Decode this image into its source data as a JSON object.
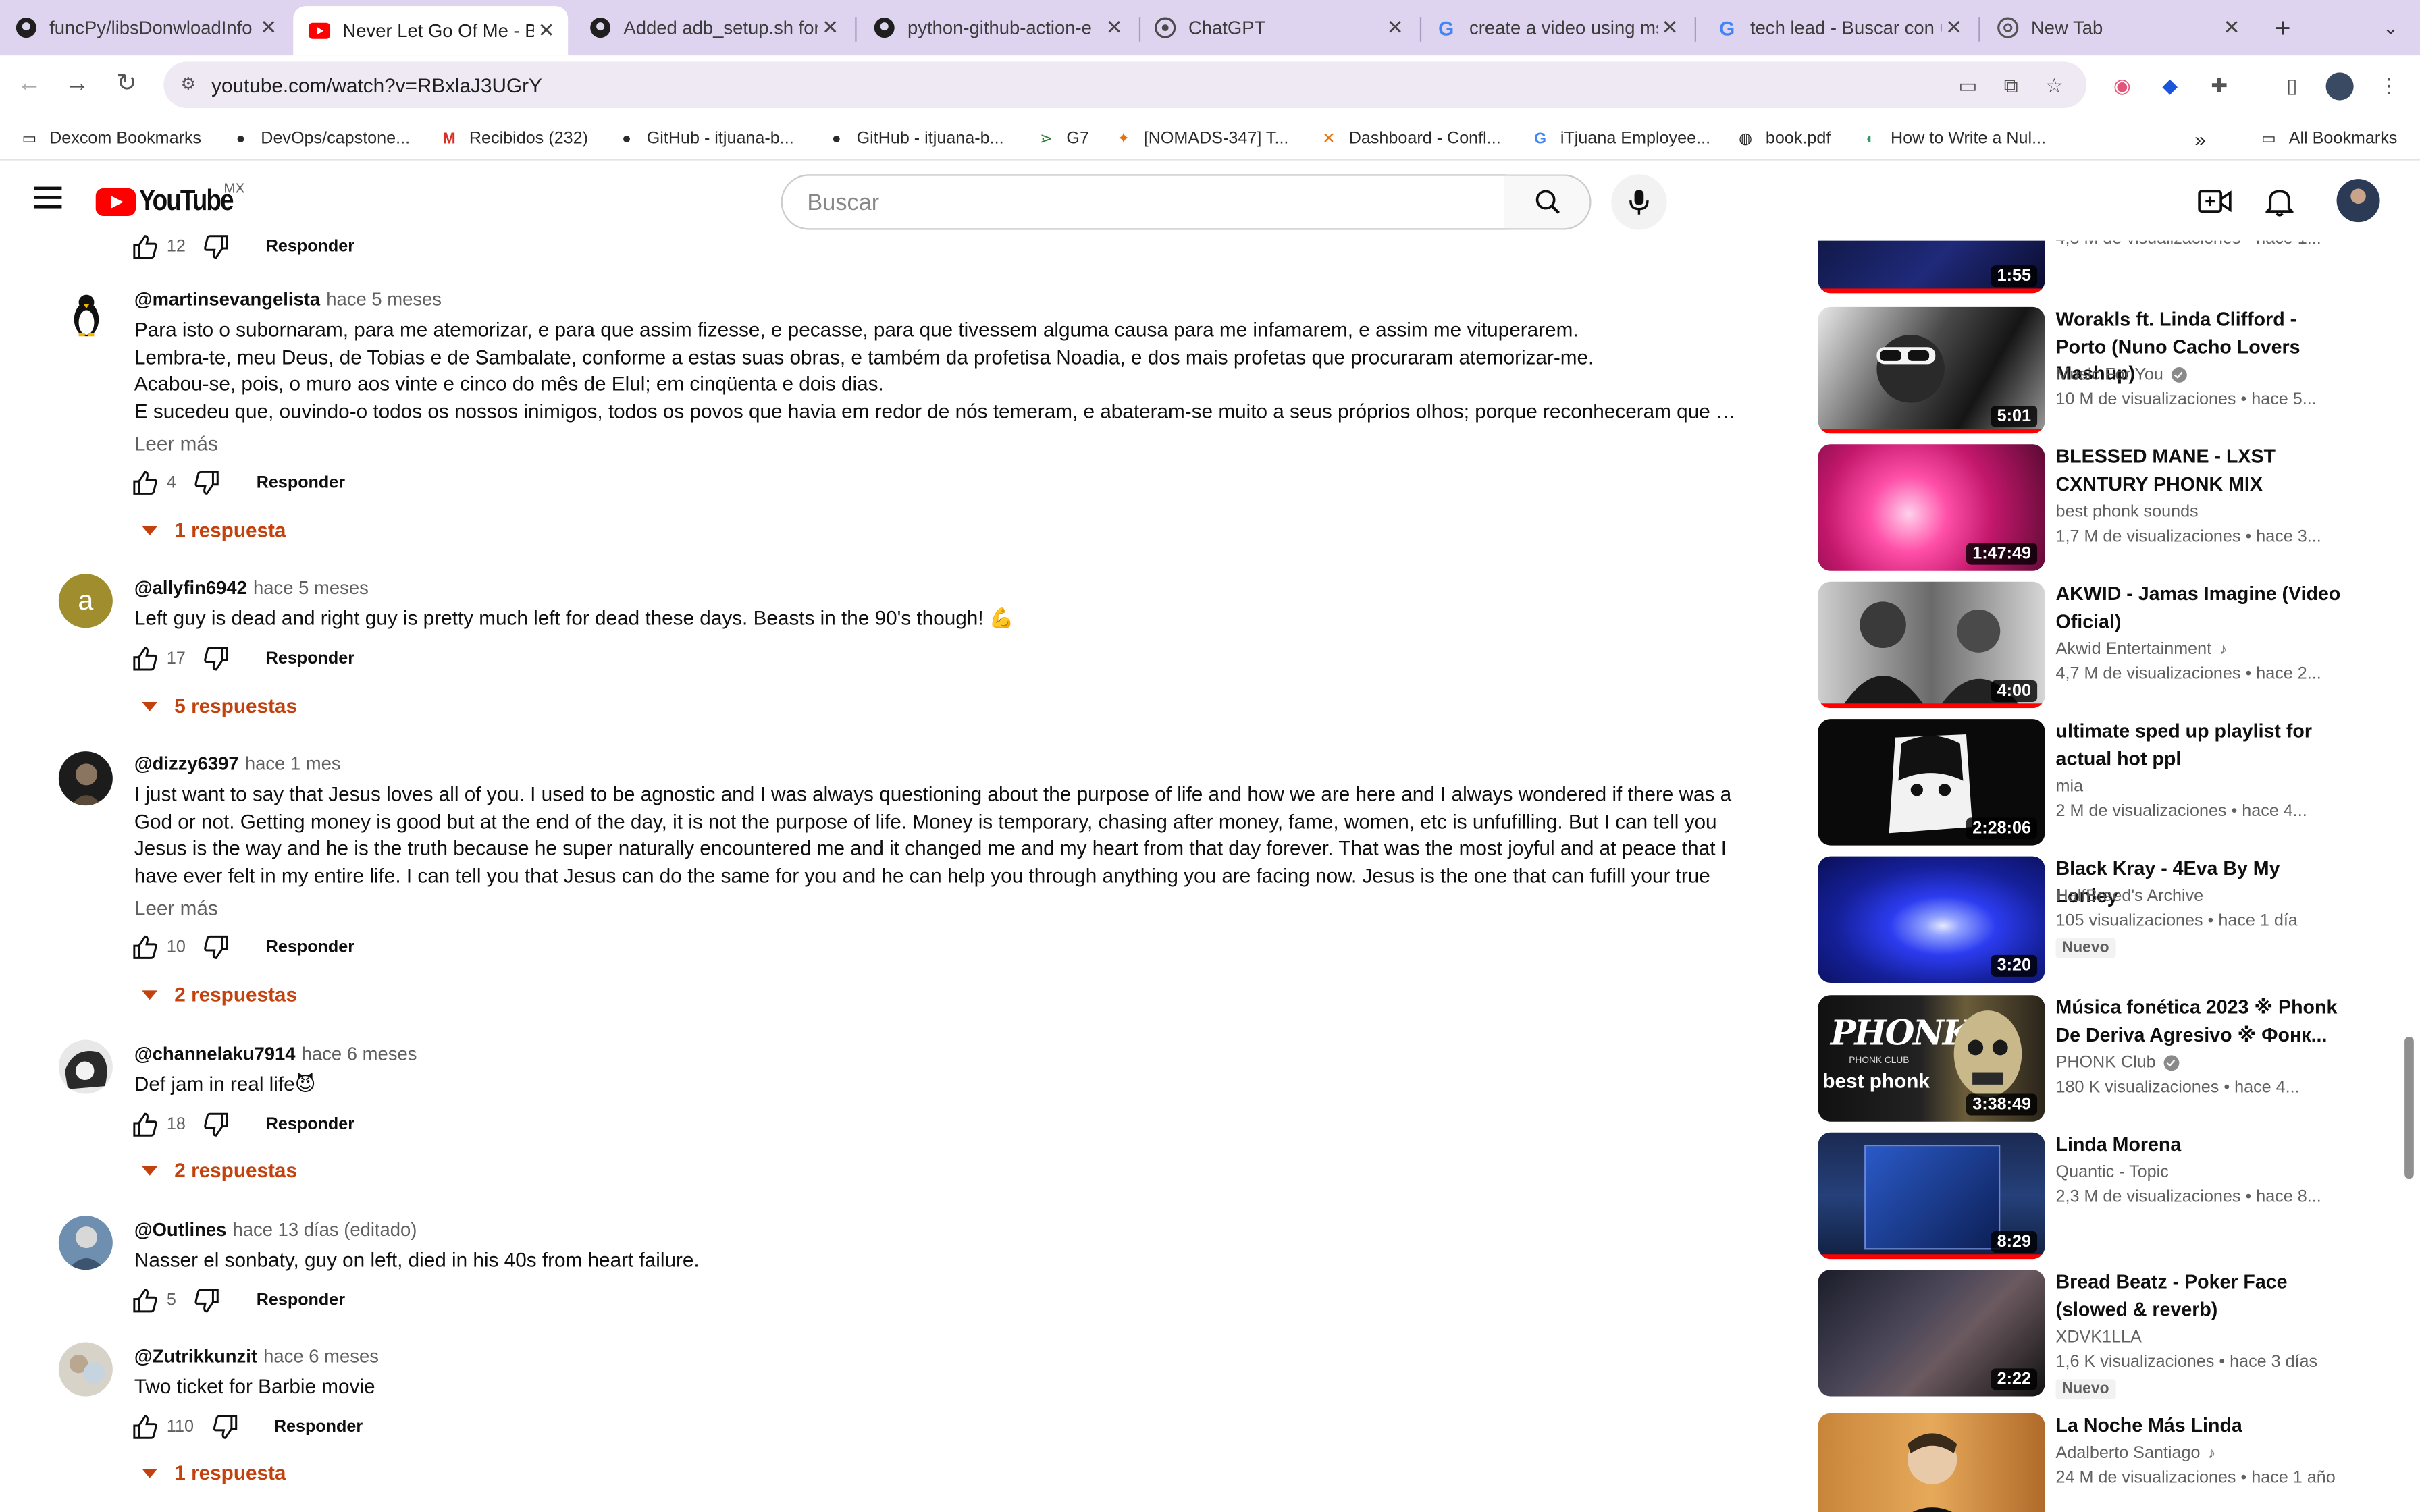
{
  "browser": {
    "tabs": [
      {
        "title": "funcPy/libsDonwloadInfo",
        "icon": "github-icon"
      },
      {
        "title": "Never Let Go Of Me - Ba",
        "icon": "youtube-icon",
        "active": true
      },
      {
        "title": "Added adb_setup.sh for",
        "icon": "github-icon"
      },
      {
        "title": "python-github-action-e",
        "icon": "github-icon"
      },
      {
        "title": "ChatGPT",
        "icon": "chatgpt-icon"
      },
      {
        "title": "create a video using ms",
        "icon": "google-icon"
      },
      {
        "title": "tech lead - Buscar con G",
        "icon": "google-icon"
      },
      {
        "title": "New Tab",
        "icon": "chrome-icon"
      }
    ],
    "url": "youtube.com/watch?v=RBxlaJ3UGrY",
    "bookmarks": [
      {
        "label": "Dexcom Bookmarks",
        "icon": "folder-icon"
      },
      {
        "label": "DevOps/capstone...",
        "icon": "github-icon"
      },
      {
        "label": "Recibidos (232)",
        "icon": "gmail-icon"
      },
      {
        "label": "GitHub - itjuana-b...",
        "icon": "github-icon"
      },
      {
        "label": "GitHub - itjuana-b...",
        "icon": "github-icon"
      },
      {
        "label": "G7",
        "icon": "g7-icon"
      },
      {
        "label": "[NOMADS-347] T...",
        "icon": "jira-icon"
      },
      {
        "label": "Dashboard - Confl...",
        "icon": "confluence-icon"
      },
      {
        "label": "iTjuana Employee...",
        "icon": "google-icon"
      },
      {
        "label": "book.pdf",
        "icon": "globe-icon"
      },
      {
        "label": "How to Write a Nul...",
        "icon": "site-icon"
      }
    ],
    "all_bookmarks": "All Bookmarks"
  },
  "youtube": {
    "logo_text": "YouTube",
    "region": "MX",
    "search_placeholder": "Buscar"
  },
  "comments": {
    "top_fragment": {
      "likes": "12",
      "reply_label": "Responder"
    },
    "items": [
      {
        "handle": "@martinsevangelista",
        "time": "hace 5 meses",
        "lines": [
          "Para isto o subornaram, para me atemorizar, e para que assim fizesse, e pecasse, para que tivessem alguma causa para me infamarem, e assim me vituperarem.",
          "Lembra-te, meu Deus, de Tobias e de Sambalate, conforme a estas suas obras, e também da profetisa Noadia, e dos mais profetas que procuraram atemorizar-me.",
          "Acabou-se, pois, o muro aos vinte e cinco do mês de Elul; em cinqüenta e dois dias.",
          "E sucedeu que, ouvindo-o todos os nossos inimigos, todos os povos que havia em redor de nós temeram, e abateram-se muito a seus próprios olhos; porque reconheceram que o nosso Deus fez esta obra."
        ],
        "read_more": "Leer más",
        "likes": "4",
        "reply_label": "Responder",
        "replies": "1 respuesta"
      },
      {
        "handle": "@allyfin6942",
        "time": "hace 5 meses",
        "avatar_letter": "a",
        "lines": [
          "Left guy is dead and right guy is pretty much left for dead these days.  Beasts in the 90's though! 💪"
        ],
        "likes": "17",
        "reply_label": "Responder",
        "replies": "5 respuestas"
      },
      {
        "handle": "@dizzy6397",
        "time": "hace 1 mes",
        "text": "I just want to say that Jesus loves all of you. I used to be agnostic and I was always questioning about the purpose of life and how we are here and I always wondered if there was a God or not. Getting money is good but at the end of the day, it is not the purpose of life. Money is temporary, chasing after money, fame, women, etc is unfufilling. But I can tell you Jesus is the way and he is the truth because he super naturally encountered me and it changed me and my heart from that day forever. That was the most joyful and at peace that I have ever felt in my entire life. I can tell you that Jesus can do the same for you and he can help you through anything you are facing now. Jesus is the one that can fufill your true purpose in life. Following Jesus is not about a …",
        "read_more": "Leer más",
        "likes": "10",
        "reply_label": "Responder",
        "replies": "2 respuestas"
      },
      {
        "handle": "@channelaku7914",
        "time": "hace 6 meses",
        "lines": [
          "Def jam in real life😈"
        ],
        "likes": "18",
        "reply_label": "Responder",
        "replies": "2 respuestas"
      },
      {
        "handle": "@Outlines",
        "time": "hace 13 días (editado)",
        "lines": [
          "Nasser el sonbaty, guy on left, died in his 40s from heart failure."
        ],
        "likes": "5",
        "reply_label": "Responder"
      },
      {
        "handle": "@Zutrikkunzit",
        "time": "hace 6 meses",
        "lines": [
          "Two ticket for Barbie movie"
        ],
        "likes": "110",
        "reply_label": "Responder",
        "replies": "1 respuesta"
      }
    ]
  },
  "sidebar": {
    "top_fragment": {
      "duration": "1:55",
      "meta": "4,8 M de visualizaciones • hace 1..."
    },
    "videos": [
      {
        "title": "Worakls ft. Linda Clifford - Porto (Nuno Cacho Lovers Mashup)",
        "channel": "Music For You",
        "verified": true,
        "meta": "10 M de visualizaciones • hace 5...",
        "duration": "5:01",
        "watched": 1.0
      },
      {
        "title": "BLESSED MANE - LXST CXNTURY PHONK MIX",
        "channel": "best phonk sounds",
        "meta": "1,7 M de visualizaciones • hace 3...",
        "duration": "1:47:49"
      },
      {
        "title": "AKWID - Jamas Imagine (Video Oficial)",
        "channel": "Akwid Entertainment",
        "music": true,
        "meta": "4,7 M de visualizaciones • hace 2...",
        "duration": "4:00",
        "watched": 1.0
      },
      {
        "title": "ultimate sped up playlist for actual hot ppl",
        "channel": "mia",
        "meta": "2 M de visualizaciones • hace 4...",
        "duration": "2:28:06"
      },
      {
        "title": "Black Kray - 4Eva By My Lonley",
        "channel": "HalfBreed's Archive",
        "meta": "105 visualizaciones • hace 1 día",
        "badge": "Nuevo",
        "duration": "3:20"
      },
      {
        "title": "Música fonética 2023 ※ Phonk De Deriva Agresivo ※ Фонк...",
        "channel": "PHONK Club",
        "verified": true,
        "meta": "180 K visualizaciones • hace 4...",
        "duration": "3:38:49",
        "thumb_text": "PHONK",
        "thumb_sub": "PHONK CLUB",
        "thumb_big": "best phonk"
      },
      {
        "title": "Linda Morena",
        "channel": "Quantic - Topic",
        "meta": "2,3 M de visualizaciones • hace 8...",
        "duration": "8:29",
        "watched": 1.0
      },
      {
        "title": "Bread Beatz - Poker Face (slowed & reverb)",
        "channel": "XDVK1LLA",
        "meta": "1,6 K visualizaciones • hace 3 días",
        "badge": "Nuevo",
        "duration": "2:22"
      },
      {
        "title": "La Noche Más Linda",
        "channel": "Adalberto Santiago",
        "music": true,
        "meta": "24 M de visualizaciones • hace 1 año",
        "duration": ""
      }
    ]
  },
  "colors": {
    "tabstrip": "#dfd4ef",
    "replies_accent": "#c2410c",
    "youtube_red": "#ff0000"
  }
}
